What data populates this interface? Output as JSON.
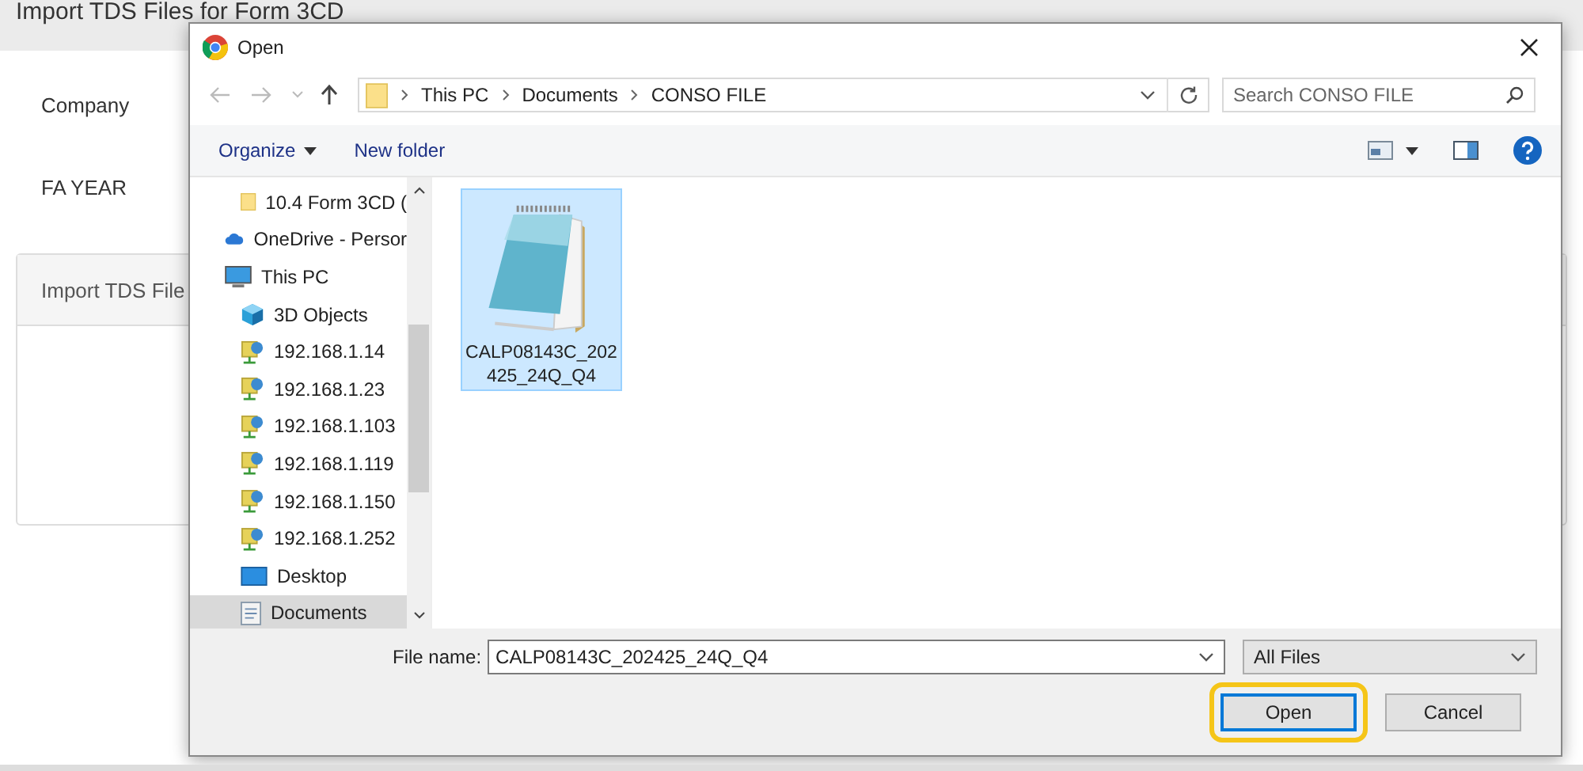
{
  "page": {
    "title": "Import TDS Files for Form 3CD",
    "fields": [
      {
        "label": "Company"
      },
      {
        "label": "FA YEAR"
      }
    ],
    "panel": {
      "title": "Import TDS File"
    }
  },
  "dialog": {
    "title": "Open",
    "address": {
      "crumbs": [
        "This PC",
        "Documents",
        "CONSO FILE"
      ]
    },
    "search": {
      "placeholder": "Search CONSO FILE"
    },
    "toolbar": {
      "organize": "Organize",
      "new_folder": "New folder"
    },
    "nav": [
      {
        "label": "10.4 Form 3CD (",
        "kind": "folder",
        "selected": false
      },
      {
        "label": "OneDrive - Persor",
        "kind": "cloud",
        "selected": false
      },
      {
        "label": "This PC",
        "kind": "pc",
        "selected": false
      },
      {
        "label": "3D Objects",
        "kind": "objects",
        "selected": false
      },
      {
        "label": "192.168.1.14",
        "kind": "network",
        "selected": false
      },
      {
        "label": "192.168.1.23",
        "kind": "network",
        "selected": false
      },
      {
        "label": "192.168.1.103",
        "kind": "network",
        "selected": false
      },
      {
        "label": "192.168.1.119",
        "kind": "network",
        "selected": false
      },
      {
        "label": "192.168.1.150",
        "kind": "network",
        "selected": false
      },
      {
        "label": "192.168.1.252",
        "kind": "network",
        "selected": false
      },
      {
        "label": "Desktop",
        "kind": "desktop",
        "selected": false
      },
      {
        "label": "Documents",
        "kind": "documents",
        "selected": true
      }
    ],
    "files": [
      {
        "name": "CALP08143C_202425_24Q_Q4",
        "selected": true
      }
    ],
    "file_name": {
      "label": "File name:",
      "value": "CALP08143C_202425_24Q_Q4"
    },
    "filter": {
      "value": "All Files"
    },
    "buttons": [
      {
        "label": "Open",
        "highlighted": true
      },
      {
        "label": "Cancel",
        "highlighted": false
      }
    ]
  }
}
